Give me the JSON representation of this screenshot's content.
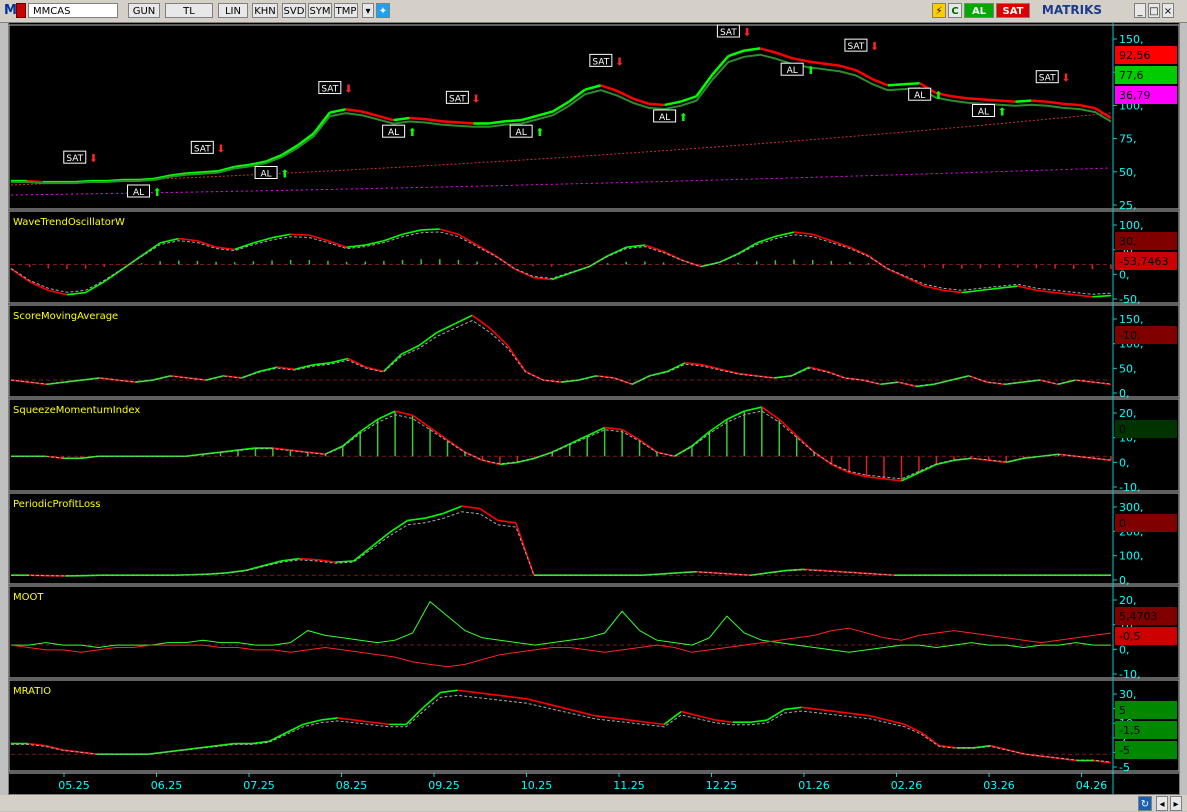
{
  "toolbar": {
    "logo": "M",
    "symbol": "MMCAS",
    "buttons": [
      "GUN",
      "TL",
      "LIN",
      "KHN",
      "SVD",
      "SYM",
      "TMP"
    ],
    "al_label": "AL",
    "sat_label": "SAT",
    "brand": "MATRIKS",
    "c_label": "C"
  },
  "colors": {
    "bg": "#000000",
    "axis": "#00ffff",
    "price_up": "#00ff00",
    "price_down": "#ff0000",
    "panel_title": "#ffff00",
    "accent_magenta": "#ff00ff"
  },
  "chart_data": [
    {
      "panel": "price",
      "type": "line",
      "title": "",
      "y_ticks": [
        "150,",
        "125,",
        "100,",
        "75,",
        "50,",
        "25,"
      ],
      "ylim": [
        0,
        160
      ],
      "x_labels": [
        "05.25",
        "06.25",
        "07.25",
        "08.25",
        "09.25",
        "10.25",
        "11.25",
        "12.25",
        "01.26",
        "02.26",
        "03.26",
        "04.26"
      ],
      "price_series": [
        22,
        22,
        21,
        21,
        21,
        22,
        22,
        23,
        23,
        24,
        27,
        29,
        30,
        31,
        35,
        37,
        40,
        46,
        55,
        66,
        85,
        88,
        86,
        82,
        78,
        80,
        79,
        77,
        76,
        75,
        75,
        77,
        78,
        82,
        86,
        95,
        106,
        110,
        105,
        98,
        93,
        92,
        95,
        100,
        120,
        137,
        142,
        144,
        140,
        135,
        132,
        130,
        128,
        124,
        116,
        110,
        111,
        112,
        103,
        100,
        98,
        97,
        96,
        95,
        96,
        95,
        93,
        92,
        89,
        80
      ],
      "values_labels": [
        "92,56",
        "77,6",
        "36,79"
      ],
      "signals": [
        {
          "label": "SAT",
          "type": "sat"
        },
        {
          "label": "AL",
          "type": "al"
        },
        {
          "label": "SAT",
          "type": "sat"
        },
        {
          "label": "AL",
          "type": "al"
        },
        {
          "label": "SAT",
          "type": "sat"
        },
        {
          "label": "AL",
          "type": "al"
        },
        {
          "label": "SAT",
          "type": "sat"
        },
        {
          "label": "AL",
          "type": "al"
        },
        {
          "label": "SAT",
          "type": "sat"
        },
        {
          "label": "AL",
          "type": "al"
        },
        {
          "label": "SAT",
          "type": "sat"
        },
        {
          "label": "AL",
          "type": "al"
        },
        {
          "label": "SAT",
          "type": "sat"
        },
        {
          "label": "AL",
          "type": "al"
        },
        {
          "label": "AL",
          "type": "al"
        },
        {
          "label": "SAT",
          "type": "sat"
        }
      ]
    },
    {
      "panel": "WaveTrendOscillatorW",
      "type": "line",
      "title": "WaveTrendOscillatorW",
      "y_ticks": [
        "100,",
        "50,",
        "0,",
        "-50,"
      ],
      "ylim": [
        -80,
        110
      ],
      "values_labels": [
        "30,",
        "-53,7463"
      ],
      "values": [
        -10,
        -40,
        -60,
        -70,
        -65,
        -40,
        -10,
        20,
        50,
        60,
        55,
        40,
        35,
        50,
        62,
        70,
        68,
        55,
        40,
        45,
        55,
        70,
        80,
        82,
        70,
        45,
        20,
        -10,
        -30,
        -35,
        -20,
        -5,
        20,
        40,
        45,
        30,
        10,
        -5,
        5,
        25,
        50,
        65,
        75,
        70,
        55,
        40,
        20,
        -10,
        -30,
        -50,
        -60,
        -65,
        -60,
        -55,
        -50,
        -60,
        -65,
        -70,
        -75,
        -72
      ]
    },
    {
      "panel": "ScoreMovingAverage",
      "type": "line",
      "title": "ScoreMovingAverage",
      "y_ticks": [
        "150,",
        "100,",
        "50,",
        "0,"
      ],
      "ylim": [
        -30,
        160
      ],
      "values_labels": [
        "-10,"
      ],
      "values": [
        0,
        -5,
        -10,
        -5,
        0,
        5,
        0,
        -5,
        0,
        10,
        5,
        0,
        10,
        5,
        20,
        30,
        25,
        35,
        40,
        50,
        30,
        20,
        60,
        80,
        110,
        130,
        150,
        120,
        80,
        20,
        0,
        -5,
        0,
        10,
        5,
        -10,
        10,
        20,
        40,
        35,
        25,
        15,
        10,
        5,
        10,
        30,
        20,
        5,
        0,
        -10,
        -5,
        -15,
        -10,
        0,
        10,
        -5,
        -10,
        -5,
        0,
        -10,
        0,
        -5,
        -10
      ]
    },
    {
      "panel": "SqueezeMomentumIndex",
      "type": "line",
      "title": "SqueezeMomentumIndex",
      "y_ticks": [
        "20,",
        "10,",
        "0,",
        "-10,"
      ],
      "ylim": [
        -15,
        25
      ],
      "values_labels": [
        "0"
      ],
      "values": [
        0,
        0,
        0,
        -1,
        -1,
        0,
        0,
        0,
        0,
        0,
        0,
        1,
        2,
        3,
        4,
        4,
        3,
        2,
        1,
        5,
        12,
        18,
        22,
        20,
        14,
        8,
        2,
        -2,
        -4,
        -3,
        -1,
        2,
        6,
        10,
        14,
        13,
        8,
        2,
        0,
        5,
        12,
        18,
        22,
        24,
        18,
        10,
        2,
        -4,
        -8,
        -10,
        -11,
        -12,
        -8,
        -4,
        -2,
        -1,
        -2,
        -3,
        -1,
        0,
        1,
        0,
        -1,
        -2
      ]
    },
    {
      "panel": "PeriodicProfitLoss",
      "type": "line",
      "title": "PeriodicProfitLoss",
      "y_ticks": [
        "300,",
        "200,",
        "100,",
        "0,"
      ],
      "ylim": [
        -20,
        320
      ],
      "values_labels": [
        "0"
      ],
      "values": [
        0,
        0,
        -2,
        -3,
        -2,
        0,
        0,
        0,
        0,
        0,
        2,
        5,
        10,
        20,
        40,
        60,
        70,
        65,
        55,
        60,
        120,
        180,
        230,
        240,
        260,
        290,
        280,
        230,
        220,
        0,
        0,
        0,
        0,
        0,
        0,
        0,
        5,
        10,
        15,
        10,
        5,
        0,
        10,
        20,
        25,
        20,
        15,
        10,
        5,
        0,
        0,
        0,
        0,
        0,
        0,
        0,
        0,
        0,
        0,
        0,
        0,
        0
      ]
    },
    {
      "panel": "MOOT",
      "type": "line",
      "title": "MOOT",
      "y_ticks": [
        "20,",
        "10,",
        "0,",
        "-10,"
      ],
      "ylim": [
        -12,
        22
      ],
      "values_labels": [
        "5,4703",
        "-0,5"
      ],
      "series": [
        {
          "values": [
            0,
            0,
            1,
            0,
            0,
            -1,
            0,
            0,
            0,
            1,
            1,
            2,
            1,
            1,
            0,
            0,
            1,
            6,
            4,
            3,
            2,
            1,
            2,
            5,
            18,
            12,
            6,
            3,
            2,
            1,
            0,
            1,
            2,
            3,
            5,
            14,
            6,
            2,
            1,
            0,
            3,
            12,
            5,
            2,
            1,
            0,
            -1,
            -2,
            -3,
            -2,
            -1,
            0,
            0,
            -1,
            0,
            1,
            0,
            0,
            -1,
            0,
            0,
            1,
            0,
            0
          ]
        },
        {
          "values": [
            0,
            -1,
            -2,
            -2,
            -3,
            -2,
            -1,
            -1,
            0,
            0,
            0,
            0,
            -1,
            -1,
            -2,
            -2,
            -3,
            -2,
            -1,
            -2,
            -3,
            -4,
            -5,
            -7,
            -8,
            -9,
            -8,
            -6,
            -4,
            -3,
            -2,
            -1,
            -1,
            -2,
            -3,
            -2,
            -1,
            0,
            -1,
            -3,
            -2,
            -1,
            0,
            1,
            2,
            3,
            4,
            6,
            7,
            5,
            3,
            2,
            4,
            5,
            6,
            5,
            4,
            3,
            2,
            1,
            2,
            3,
            4,
            5
          ]
        }
      ]
    },
    {
      "panel": "MRATIO",
      "type": "line",
      "title": "MRATIO",
      "y_ticks": [
        "30,",
        "20,",
        "10,",
        "5",
        "-1,5",
        "-5"
      ],
      "ylim": [
        -6,
        32
      ],
      "values_labels": [
        "5",
        "-1,5",
        "-5"
      ],
      "values": [
        5,
        5,
        4,
        2,
        1,
        0,
        0,
        0,
        0,
        1,
        2,
        3,
        4,
        5,
        5,
        6,
        10,
        14,
        16,
        17,
        16,
        15,
        14,
        14,
        22,
        29,
        30,
        29,
        28,
        27,
        26,
        24,
        22,
        20,
        18,
        17,
        16,
        15,
        14,
        20,
        18,
        16,
        15,
        15,
        16,
        21,
        22,
        21,
        20,
        19,
        18,
        16,
        14,
        10,
        4,
        3,
        3,
        4,
        2,
        0,
        -1,
        -2,
        -3,
        -3,
        -4
      ]
    }
  ]
}
